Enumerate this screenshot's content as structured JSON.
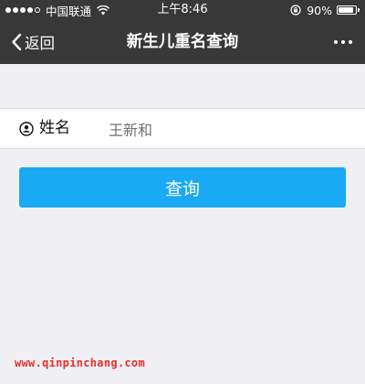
{
  "status_bar": {
    "carrier": "中国联通",
    "time": "上午8:46",
    "battery_text": "90%",
    "battery_level": 0.9,
    "signal_bars": 4,
    "icons": [
      "signal-icon",
      "wifi-icon",
      "rotation-lock-icon",
      "battery-icon"
    ]
  },
  "nav": {
    "back_label": "返回",
    "title": "新生儿重名查询",
    "back_icon": "chevron-left-icon",
    "more_icon": "more-dots-icon"
  },
  "form": {
    "name_label": "姓名",
    "name_value": "王新和",
    "name_icon": "user-circle-icon",
    "submit_label": "查询"
  },
  "watermark": {
    "text": "www.qinpinchang.com"
  },
  "colors": {
    "bar_background": "#383838",
    "page_background": "#efeff4",
    "button": "#1aa9f4",
    "watermark": "#e8302a"
  }
}
